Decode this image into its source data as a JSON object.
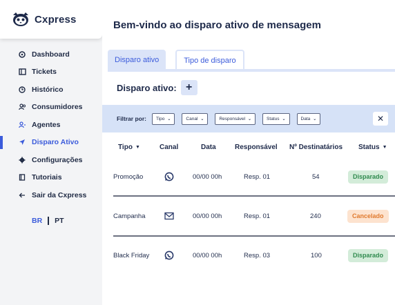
{
  "brand": {
    "name": "Cxpress"
  },
  "sidebar": {
    "items": [
      {
        "label": "Dashboard",
        "icon": "dashboard-icon"
      },
      {
        "label": "Tickets",
        "icon": "ticket-icon"
      },
      {
        "label": "Histórico",
        "icon": "history-icon"
      },
      {
        "label": "Consumidores",
        "icon": "users-icon"
      },
      {
        "label": "Agentes",
        "icon": "agent-icon"
      },
      {
        "label": "Disparo Ativo",
        "icon": "send-icon"
      },
      {
        "label": "Configurações",
        "icon": "gear-icon"
      },
      {
        "label": "Tutoriais",
        "icon": "book-icon"
      },
      {
        "label": "Sair da Cxpress",
        "icon": "arrow-left-icon"
      }
    ],
    "active": "Disparo Ativo",
    "lang": {
      "br": "BR",
      "pt": "PT"
    }
  },
  "main": {
    "title": "Bem-vindo ao disparo ativo de mensagem",
    "tabs": [
      {
        "label": "Disparo ativo"
      },
      {
        "label": "Tipo de disparo"
      }
    ],
    "disparo_label": "Disparo ativo:",
    "add_label": "+",
    "filter": {
      "label": "Filtrar por:",
      "options": [
        "Tipo",
        "Canal",
        "Responsável",
        "Status",
        "Data"
      ],
      "close_label": "✕"
    },
    "table": {
      "headers": [
        "Tipo",
        "Canal",
        "Data",
        "Responsável",
        "Nº Destinatários",
        "Status"
      ],
      "rows": [
        {
          "tipo": "Promoção",
          "canal": "whatsapp-icon",
          "data": "00/00 00h",
          "responsavel": "Resp. 01",
          "destinatarios": "54",
          "status": "Disparado"
        },
        {
          "tipo": "Campanha",
          "canal": "email-icon",
          "data": "00/00 00h",
          "responsavel": "Resp. 01",
          "destinatarios": "240",
          "status": "Cancelado"
        },
        {
          "tipo": "Black Friday",
          "canal": "whatsapp-icon",
          "data": "00/00 00h",
          "responsavel": "Resp. 03",
          "destinatarios": "100",
          "status": "Disparado"
        }
      ]
    }
  },
  "colors": {
    "accent": "#3b5bdb",
    "tab_bg": "#dbe4f8",
    "filter_bg": "#d6e2f7",
    "disparado_bg": "#d3ecd9",
    "disparado_text": "#2f8a4e",
    "cancelado_bg": "#fde3cf",
    "cancelado_text": "#e07a2e"
  }
}
